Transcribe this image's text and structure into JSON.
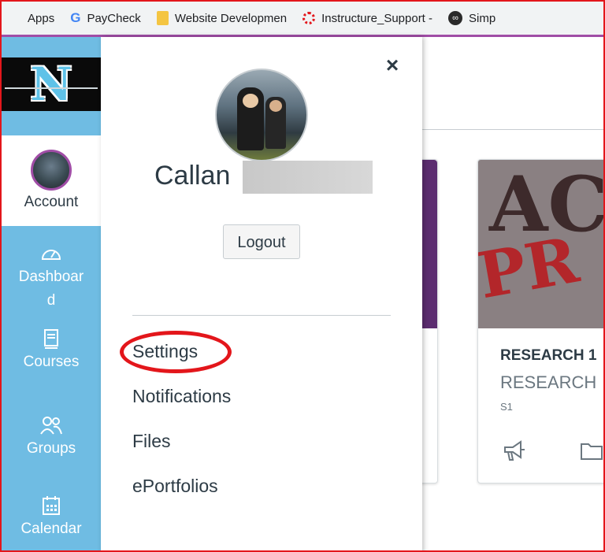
{
  "bookmarks": [
    {
      "label": "Apps",
      "icon": "apps-grid-icon"
    },
    {
      "label": "PayCheck",
      "icon": "google-icon"
    },
    {
      "label": "Website Developmen",
      "icon": "folder-icon"
    },
    {
      "label": "Instructure_Support -",
      "icon": "instructure-icon"
    },
    {
      "label": "Simp",
      "icon": "simple-icon"
    }
  ],
  "nav": {
    "logo": "N",
    "account": "Account",
    "dashboard_line1": "Dashboar",
    "dashboard_line2": "d",
    "courses": "Courses",
    "groups": "Groups",
    "calendar": "Calendar"
  },
  "tray": {
    "close": "×",
    "user_name": "Callan",
    "logout": "Logout",
    "links": [
      "Settings",
      "Notifications",
      "Files",
      "ePortfolios"
    ]
  },
  "card": {
    "image_text_1": "AC",
    "image_text_2": "PR",
    "course_code": "RESEARCH 1",
    "course_name": "RESEARCH",
    "term": "S1"
  },
  "colors": {
    "nav_bg": "#6fbce3",
    "highlight": "#e3161b",
    "text": "#2d3b45"
  }
}
